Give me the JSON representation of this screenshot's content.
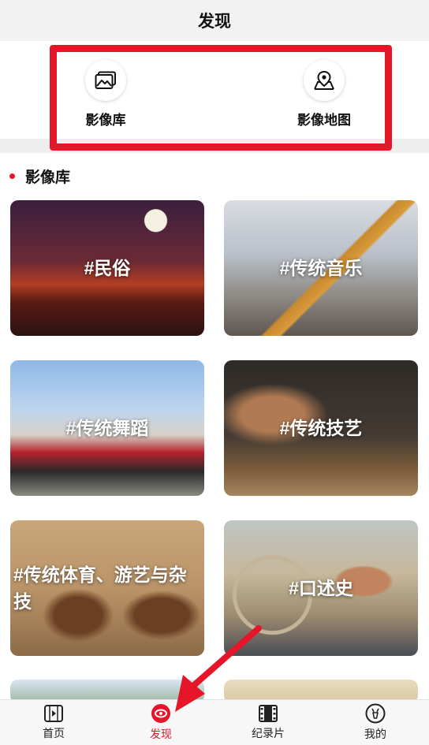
{
  "header": {
    "title": "发现"
  },
  "quick_links": [
    {
      "label": "影像库",
      "icon": "image-gallery-icon"
    },
    {
      "label": "影像地图",
      "icon": "map-pin-icon"
    }
  ],
  "section": {
    "title": "影像库"
  },
  "categories": [
    {
      "label": "#民俗"
    },
    {
      "label": "#传统音乐"
    },
    {
      "label": "#传统舞蹈"
    },
    {
      "label": "#传统技艺"
    },
    {
      "label": "#传统体育、游艺与杂技"
    },
    {
      "label": "#口述史"
    }
  ],
  "tabbar": [
    {
      "label": "首页",
      "icon": "home-play-icon"
    },
    {
      "label": "发现",
      "icon": "discover-eye-icon",
      "active": true
    },
    {
      "label": "纪录片",
      "icon": "film-icon"
    },
    {
      "label": "我的",
      "icon": "profile-deer-icon"
    }
  ],
  "colors": {
    "accent": "#e5162a",
    "header_bg": "#f2f2f2"
  }
}
